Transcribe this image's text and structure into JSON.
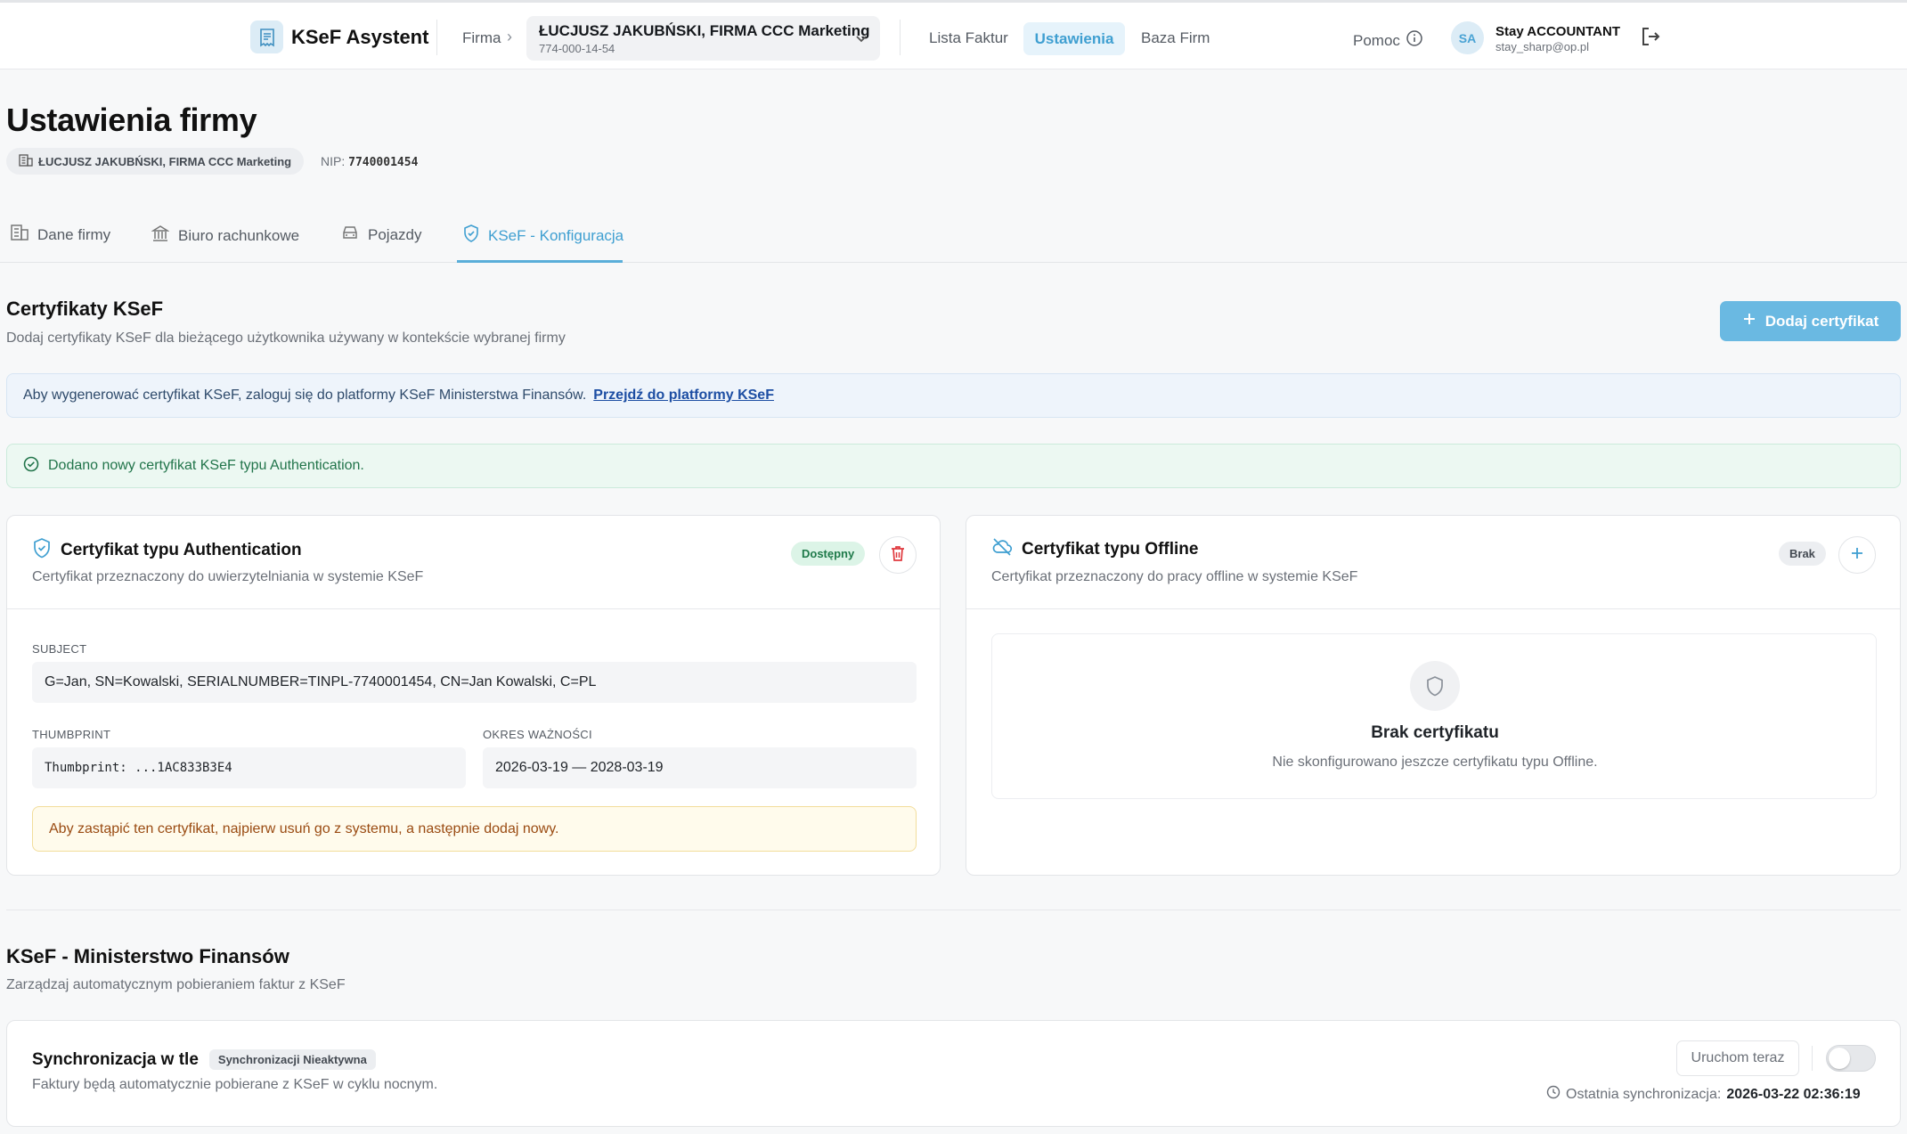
{
  "header": {
    "brand": "KSeF Asystent",
    "firma_label": "Firma",
    "company_name": "ŁUCJUSZ JAKUBŃSKI, FIRMA CCC Marketing",
    "company_nip": "774-000-14-54",
    "nav": [
      "Lista Faktur",
      "Ustawienia",
      "Baza Firm"
    ],
    "help": "Pomoc",
    "avatar_initials": "SA",
    "user_name": "Stay ACCOUNTANT",
    "user_email": "stay_sharp@op.pl"
  },
  "page": {
    "title": "Ustawienia firmy",
    "company_chip": "ŁUCJUSZ JAKUBŃSKI, FIRMA CCC Marketing",
    "nip_label": "NIP:",
    "nip_value": "7740001454"
  },
  "tabs": [
    {
      "label": "Dane firmy",
      "icon": "building-icon"
    },
    {
      "label": "Biuro rachunkowe",
      "icon": "bank-icon"
    },
    {
      "label": "Pojazdy",
      "icon": "car-icon"
    },
    {
      "label": "KSeF - Konfiguracja",
      "icon": "shield-icon",
      "active": true
    }
  ],
  "certificates": {
    "title": "Certyfikaty KSeF",
    "subtitle": "Dodaj certyfikaty KSeF dla bieżącego użytkownika używany w kontekście wybranej firmy",
    "add_button": "Dodaj certyfikat",
    "info_text": "Aby wygenerować certyfikat KSeF, zaloguj się do platformy KSeF Ministerstwa Finansów.",
    "info_link": "Przejdź do platformy KSeF",
    "success_text": "Dodano nowy certyfikat KSeF typu Authentication.",
    "auth_card": {
      "title": "Certyfikat typu Authentication",
      "subtitle": "Certyfikat przeznaczony do uwierzytelniania w systemie KSeF",
      "status": "Dostępny",
      "subject_label": "SUBJECT",
      "subject_value": "G=Jan, SN=Kowalski, SERIALNUMBER=TINPL-7740001454, CN=Jan Kowalski, C=PL",
      "thumbprint_label": "THUMBPRINT",
      "thumbprint_value": "Thumbprint: ...1AC833B3E4",
      "validity_label": "OKRES WAŻNOŚCI",
      "validity_value": "2026-03-19 — 2028-03-19",
      "warning": "Aby zastąpić ten certyfikat, najpierw usuń go z systemu, a następnie dodaj nowy."
    },
    "offline_card": {
      "title": "Certyfikat typu Offline",
      "subtitle": "Certyfikat przeznaczony do pracy offline w systemie KSeF",
      "status": "Brak",
      "empty_title": "Brak certyfikatu",
      "empty_subtitle": "Nie skonfigurowano jeszcze certyfikatu typu Offline."
    }
  },
  "ministry": {
    "title": "KSeF - Ministerstwo Finansów",
    "subtitle": "Zarządzaj automatycznym pobieraniem faktur z KSeF",
    "sync_title": "Synchronizacja w tle",
    "sync_badge": "Synchronizacji Nieaktywna",
    "sync_desc": "Faktury będą automatycznie pobierane z KSeF w cyklu nocnym.",
    "run_now": "Uruchom teraz",
    "toggle_on": false,
    "last_sync_label": "Ostatnia synchronizacja:",
    "last_sync_value": "2026-03-22 02:36:19"
  },
  "colors": {
    "accent": "#3f9fd1",
    "primary_button": "#6ab9e2",
    "success": "#21744a",
    "danger": "#e0393e",
    "warning": "#9a4b12"
  }
}
